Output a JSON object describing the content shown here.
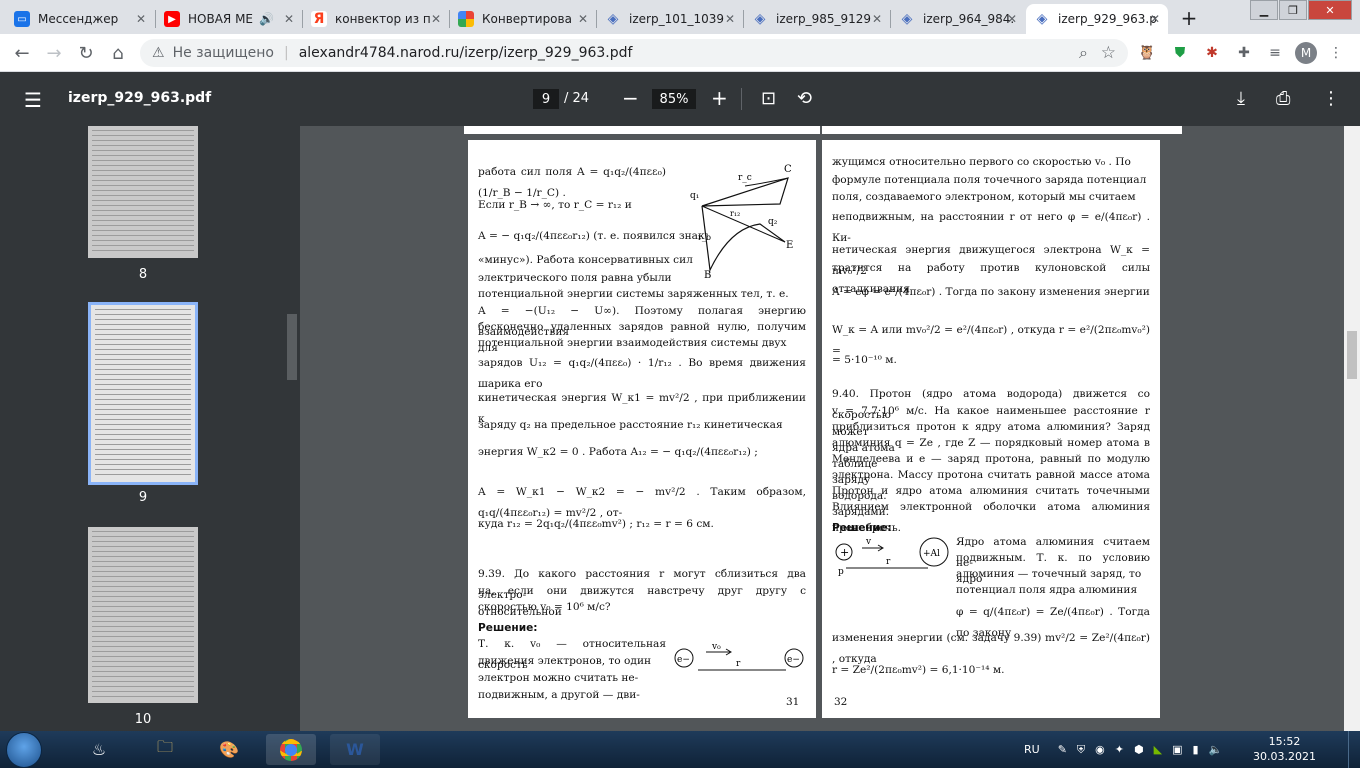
{
  "browser": {
    "tabs": [
      {
        "title": "Мессенджер",
        "icon_color": "#1a73e8"
      },
      {
        "title": "НОВАЯ МЕ",
        "icon_color": "#ff0000"
      },
      {
        "title": "конвектор из п",
        "icon_color": "#fc3f1d"
      },
      {
        "title": "Конвертирова",
        "icon_color": "#4285f4"
      },
      {
        "title": "izerp_101_1039",
        "icon_color": "#4a6fbf"
      },
      {
        "title": "izerp_985_9129",
        "icon_color": "#4a6fbf"
      },
      {
        "title": "izerp_964_984.",
        "icon_color": "#4a6fbf"
      },
      {
        "title": "izerp_929_963.p",
        "icon_color": "#4a6fbf"
      }
    ],
    "address": {
      "security": "Не защищено",
      "url": "alexandr4784.narod.ru/izerp/izerp_929_963.pdf"
    },
    "avatar_letter": "M"
  },
  "pdf": {
    "file_name": "izerp_929_963.pdf",
    "current_page": "9",
    "total_pages": "/ 24",
    "zoom": "85%",
    "thumbnails": [
      {
        "label": "8"
      },
      {
        "label": "9"
      },
      {
        "label": "10"
      }
    ],
    "left_page": {
      "lines": [
        "работа сил поля  A = q₁q₂/(4πεε₀) (1/r_B − 1/r_C) .",
        "Если   r_B → ∞,   то   r_C = r₁₂   и",
        "A = − q₁q₂/(4πεε₀r₁₂)   (т. е. появился знак",
        "«минус»). Работа консервативных сил",
        "электрического поля равна убыли",
        "потенциальной энергии системы заряженных тел, т. е.",
        "A = −(U₁₂ − U∞). Поэтому полагая энергию взаимодействия",
        "бесконечно удаленных зарядов равной нулю, получим для",
        "потенциальной энергии взаимодействия системы двух",
        "зарядов  U₁₂ = q₁q₂/(4πεε₀) · 1/r₁₂ . Во время движения шарика его",
        "кинетическая энергия  W_к1 = mv²/2 , при приближении к",
        "заряду  q₂  на предельное расстояние  r₁₂  кинетическая",
        "энергия        W_к2 = 0 .           Работа         A₁₂ = − q₁q₂/(4πεε₀r₁₂) ;",
        "A = W_к1 − W_к2 = − mv²/2 . Таким образом,  q₁q/(4πεε₀r₁₂) = mv²/2 , от-",
        "куда  r₁₂ = 2q₁q₂/(4πεε₀mv²) ;  r₁₂ = r = 6 см.",
        "9.39. До какого расстояния r могут сблизиться два электро-",
        "на, если они движутся навстречу друг другу с относительной",
        "скоростью  v₀ = 10⁶ м/с?",
        "Решение:",
        "Т. к. v₀ — относительная скорость",
        "движения электронов, то один",
        "электрон можно считать не-",
        "подвижным, а другой — дви-"
      ],
      "page_number": "31",
      "figure_labels": {
        "c": "C",
        "rc": "r_c",
        "q1": "q₁",
        "r12": "r₁₂",
        "q2": "q₂",
        "rb": "r_b",
        "e": "E",
        "b": "B"
      },
      "electron_labels": {
        "e1": "e−",
        "e2": "e−",
        "v0": "v₀",
        "r": "r"
      }
    },
    "right_page": {
      "lines": [
        "жущимся относительно первого со скоростью  v₀ . По",
        "формуле потенциала поля точечного заряда потенциал",
        "поля, создаваемого электроном, который мы считаем",
        "неподвижным, на расстоянии  r  от него  φ = e/(4πε₀r) . Ки-",
        "нетическая энергия движущегося электрона  W_к = mv₀²/2",
        "тратится на работу против кулоновской силы отталкивания",
        "A = eφ = e²/(4πε₀r) .   Тогда по закону изменения энергии",
        "W_к = A        или        mv₀²/2 = e²/(4πε₀r) ,       откуда     r = e²/(2πε₀mv₀²) =",
        "= 5·10⁻¹⁰ м.",
        "9.40. Протон (ядро атома водорода) движется со скоростью",
        "v = 7,7·10⁶ м/с. На какое наименьшее расстояние r может",
        "приблизиться протон к ядру атома алюминия? Заряд ядра атома",
        "алюминия  q = Ze , где  Z  — порядковый номер атома в таблице",
        "Менделеева и  e  — заряд протона, равный по модулю заряду",
        "электрона. Массу протона считать равной массе атома водорода.",
        "Протон и ядро атома алюминия считать точечными зарядами.",
        "Влиянием электронной оболочки атома алюминия пренебречь.",
        "Решение:",
        "Ядро атома алюминия считаем не-",
        "подвижным. Т. к. по условию ядро",
        "алюминия — точечный заряд, то",
        "потенциал поля ядра алюминия",
        "φ = q/(4πε₀r) = Ze/(4πε₀r) . Тогда по закону",
        "изменения энергии (см. задачу 9.39)  mv²/2 = Ze²/(4πε₀r) , откуда",
        "r = Ze²/(2πε₀mv²) = 6,1·10⁻¹⁴ м."
      ],
      "page_number": "32",
      "proton_labels": {
        "plus": "+",
        "v": "v",
        "p": "p",
        "r": "r",
        "al": "+Al"
      }
    }
  },
  "taskbar": {
    "lang": "RU",
    "time": "15:52",
    "date": "30.03.2021"
  }
}
